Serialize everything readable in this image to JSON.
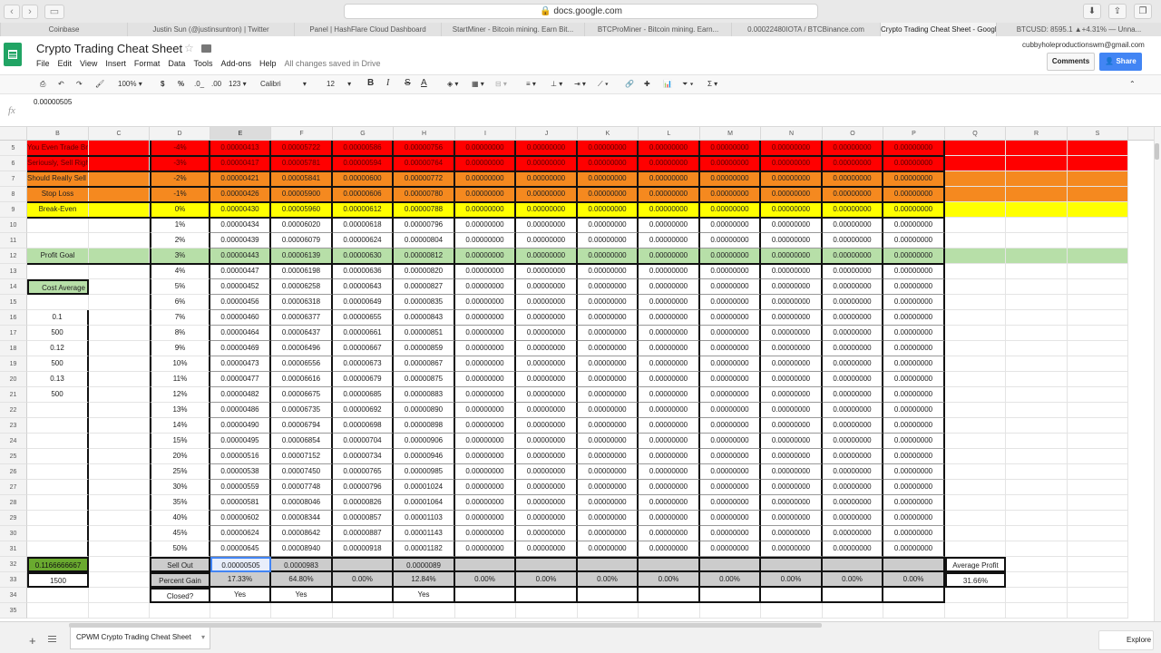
{
  "browser": {
    "url": "docs.google.com",
    "tabs": [
      "Coinbase",
      "Justin Sun (@justinsuntron) | Twitter",
      "Panel | HashFlare Cloud Dashboard",
      "StartMiner - Bitcoin mining. Earn Bit...",
      "BTCProMiner - Bitcoin mining. Earn...",
      "0.00022480IOTA / BTCBinance.com",
      "Crypto Trading Cheat Sheet - Googl...",
      "BTCUSD: 8595.1 ▲+4.31% — Unna..."
    ],
    "active_tab": 6
  },
  "doc": {
    "title": "Crypto Trading Cheat Sheet",
    "status": "All changes saved in Drive",
    "email": "cubbyholeproductionswm@gmail.com",
    "menus": [
      "File",
      "Edit",
      "View",
      "Insert",
      "Format",
      "Data",
      "Tools",
      "Add-ons",
      "Help"
    ],
    "comments_label": "Comments",
    "share_label": "Share"
  },
  "toolbar": {
    "zoom": "100%",
    "currency": "$",
    "percent": "%",
    "dec_less": ".0_",
    "dec_more": ".00",
    "number_format": "123",
    "font": "Calibri",
    "font_size": "12",
    "bold": "B",
    "italic": "I",
    "strike": "S",
    "text_color": "A"
  },
  "formula_bar": {
    "fx": "fx",
    "value": "0.00000505"
  },
  "columns": [
    "B",
    "C",
    "D",
    "E",
    "F",
    "G",
    "H",
    "I",
    "J",
    "K",
    "L",
    "M",
    "N",
    "O",
    "P",
    "Q",
    "R",
    "S"
  ],
  "selected_column": "E",
  "row_numbers": [
    "5",
    "6",
    "7",
    "8",
    "9",
    "10",
    "11",
    "12",
    "13",
    "14",
    "15",
    "16",
    "17",
    "18",
    "19",
    "20",
    "21",
    "22",
    "23",
    "24",
    "25",
    "26",
    "27",
    "28",
    "29",
    "30",
    "31",
    "32",
    "33",
    "34",
    "35"
  ],
  "colors": {
    "red": "#ff0000",
    "orange": "#f5891f",
    "yellow": "#ffff00",
    "light_green": "#b7dfa8",
    "dark_green": "#6aaa2f",
    "gray": "#cccccc",
    "selection": "#4285f4"
  },
  "rows": [
    {
      "b": "You Even Trade Bro?",
      "d": "-4%",
      "vals": [
        "0.00000413",
        "0.00005722",
        "0.00000586",
        "0.00000756"
      ],
      "band": "red"
    },
    {
      "b": "Seriously, Sell Right Now!",
      "d": "-3%",
      "vals": [
        "0.00000417",
        "0.00005781",
        "0.00000594",
        "0.00000764"
      ],
      "band": "red"
    },
    {
      "b": "Should Really Sell Now",
      "d": "-2%",
      "vals": [
        "0.00000421",
        "0.00005841",
        "0.00000600",
        "0.00000772"
      ],
      "band": "orange"
    },
    {
      "b": "Stop Loss",
      "d": "-1%",
      "vals": [
        "0.00000426",
        "0.00005900",
        "0.00000606",
        "0.00000780"
      ],
      "band": "orange"
    },
    {
      "b": "Break-Even",
      "d": "0%",
      "vals": [
        "0.00000430",
        "0.00005960",
        "0.00000612",
        "0.00000788"
      ],
      "band": "yellow"
    },
    {
      "b": "",
      "d": "1%",
      "vals": [
        "0.00000434",
        "0.00006020",
        "0.00000618",
        "0.00000796"
      ],
      "band": "none"
    },
    {
      "b": "",
      "d": "2%",
      "vals": [
        "0.00000439",
        "0.00006079",
        "0.00000624",
        "0.00000804"
      ],
      "band": "none"
    },
    {
      "b": "Profit Goal",
      "d": "3%",
      "vals": [
        "0.00000443",
        "0.00006139",
        "0.00000630",
        "0.00000812"
      ],
      "band": "green"
    },
    {
      "b": "",
      "d": "4%",
      "vals": [
        "0.00000447",
        "0.00006198",
        "0.00000636",
        "0.00000820"
      ],
      "band": "none"
    },
    {
      "b": "Cost Average",
      "d": "5%",
      "vals": [
        "0.00000452",
        "0.00006258",
        "0.00000643",
        "0.00000827"
      ],
      "band": "none"
    },
    {
      "b": "",
      "d": "6%",
      "vals": [
        "0.00000456",
        "0.00006318",
        "0.00000649",
        "0.00000835"
      ],
      "band": "none"
    },
    {
      "b": "0.1",
      "d": "7%",
      "vals": [
        "0.00000460",
        "0.00006377",
        "0.00000655",
        "0.00000843"
      ],
      "band": "none"
    },
    {
      "b": "500",
      "d": "8%",
      "vals": [
        "0.00000464",
        "0.00006437",
        "0.00000661",
        "0.00000851"
      ],
      "band": "none"
    },
    {
      "b": "0.12",
      "d": "9%",
      "vals": [
        "0.00000469",
        "0.00006496",
        "0.00000667",
        "0.00000859"
      ],
      "band": "none"
    },
    {
      "b": "500",
      "d": "10%",
      "vals": [
        "0.00000473",
        "0.00006556",
        "0.00000673",
        "0.00000867"
      ],
      "band": "none"
    },
    {
      "b": "0.13",
      "d": "11%",
      "vals": [
        "0.00000477",
        "0.00006616",
        "0.00000679",
        "0.00000875"
      ],
      "band": "none"
    },
    {
      "b": "500",
      "d": "12%",
      "vals": [
        "0.00000482",
        "0.00006675",
        "0.00000685",
        "0.00000883"
      ],
      "band": "none"
    },
    {
      "b": "",
      "d": "13%",
      "vals": [
        "0.00000486",
        "0.00006735",
        "0.00000692",
        "0.00000890"
      ],
      "band": "none"
    },
    {
      "b": "",
      "d": "14%",
      "vals": [
        "0.00000490",
        "0.00006794",
        "0.00000698",
        "0.00000898"
      ],
      "band": "none"
    },
    {
      "b": "",
      "d": "15%",
      "vals": [
        "0.00000495",
        "0.00006854",
        "0.00000704",
        "0.00000906"
      ],
      "band": "none"
    },
    {
      "b": "",
      "d": "20%",
      "vals": [
        "0.00000516",
        "0.00007152",
        "0.00000734",
        "0.00000946"
      ],
      "band": "none"
    },
    {
      "b": "",
      "d": "25%",
      "vals": [
        "0.00000538",
        "0.00007450",
        "0.00000765",
        "0.00000985"
      ],
      "band": "none"
    },
    {
      "b": "",
      "d": "30%",
      "vals": [
        "0.00000559",
        "0.00007748",
        "0.00000796",
        "0.00001024"
      ],
      "band": "none"
    },
    {
      "b": "",
      "d": "35%",
      "vals": [
        "0.00000581",
        "0.00008046",
        "0.00000826",
        "0.00001064"
      ],
      "band": "none"
    },
    {
      "b": "",
      "d": "40%",
      "vals": [
        "0.00000602",
        "0.00008344",
        "0.00000857",
        "0.00001103"
      ],
      "band": "none"
    },
    {
      "b": "",
      "d": "45%",
      "vals": [
        "0.00000624",
        "0.00008642",
        "0.00000887",
        "0.00001143"
      ],
      "band": "none"
    },
    {
      "b": "",
      "d": "50%",
      "vals": [
        "0.00000645",
        "0.00008940",
        "0.00000918",
        "0.00001182"
      ],
      "band": "none"
    }
  ],
  "zero_value": "0.00000000",
  "summary": {
    "sell_out": {
      "b": "0.1166666667",
      "d": "Sell Out",
      "vals": [
        "0.00000505",
        "0.0000983",
        "",
        "0.0000089",
        "",
        "",
        "",
        "",
        "",
        "",
        "",
        ""
      ],
      "q": "Average Profit"
    },
    "percent_gain": {
      "b": "1500",
      "d": "Percent Gain",
      "vals": [
        "17.33%",
        "64.80%",
        "0.00%",
        "12.84%",
        "0.00%",
        "0.00%",
        "0.00%",
        "0.00%",
        "0.00%",
        "0.00%",
        "0.00%",
        "0.00%"
      ],
      "q": "31.66%"
    },
    "closed": {
      "d": "Closed?",
      "vals": [
        "Yes",
        "Yes",
        "",
        "Yes",
        "",
        "",
        "",
        "",
        "",
        "",
        "",
        ""
      ]
    }
  },
  "sheet_tab": "CPWM Crypto Trading Cheat Sheet",
  "explore_label": "Explore"
}
